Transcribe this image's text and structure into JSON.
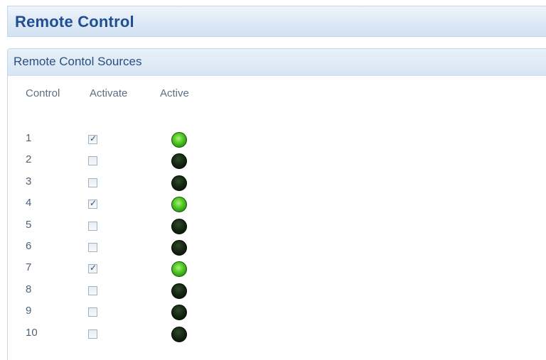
{
  "header": {
    "title": "Remote Control"
  },
  "panel": {
    "title": "Remote Contol Sources",
    "columns": {
      "control": "Control",
      "activate": "Activate",
      "active": "Active"
    }
  },
  "rows": [
    {
      "control": "1",
      "activate": true,
      "active": true
    },
    {
      "control": "2",
      "activate": false,
      "active": false
    },
    {
      "control": "3",
      "activate": false,
      "active": false
    },
    {
      "control": "4",
      "activate": true,
      "active": true
    },
    {
      "control": "5",
      "activate": false,
      "active": false
    },
    {
      "control": "6",
      "activate": false,
      "active": false
    },
    {
      "control": "7",
      "activate": true,
      "active": true
    },
    {
      "control": "8",
      "activate": false,
      "active": false
    },
    {
      "control": "9",
      "activate": false,
      "active": false
    },
    {
      "control": "10",
      "activate": false,
      "active": false
    }
  ],
  "colors": {
    "title_text": "#1f4e96",
    "panel_title_text": "#2a4f82",
    "led_on": "#3fbf1f",
    "led_off": "#12230f"
  }
}
